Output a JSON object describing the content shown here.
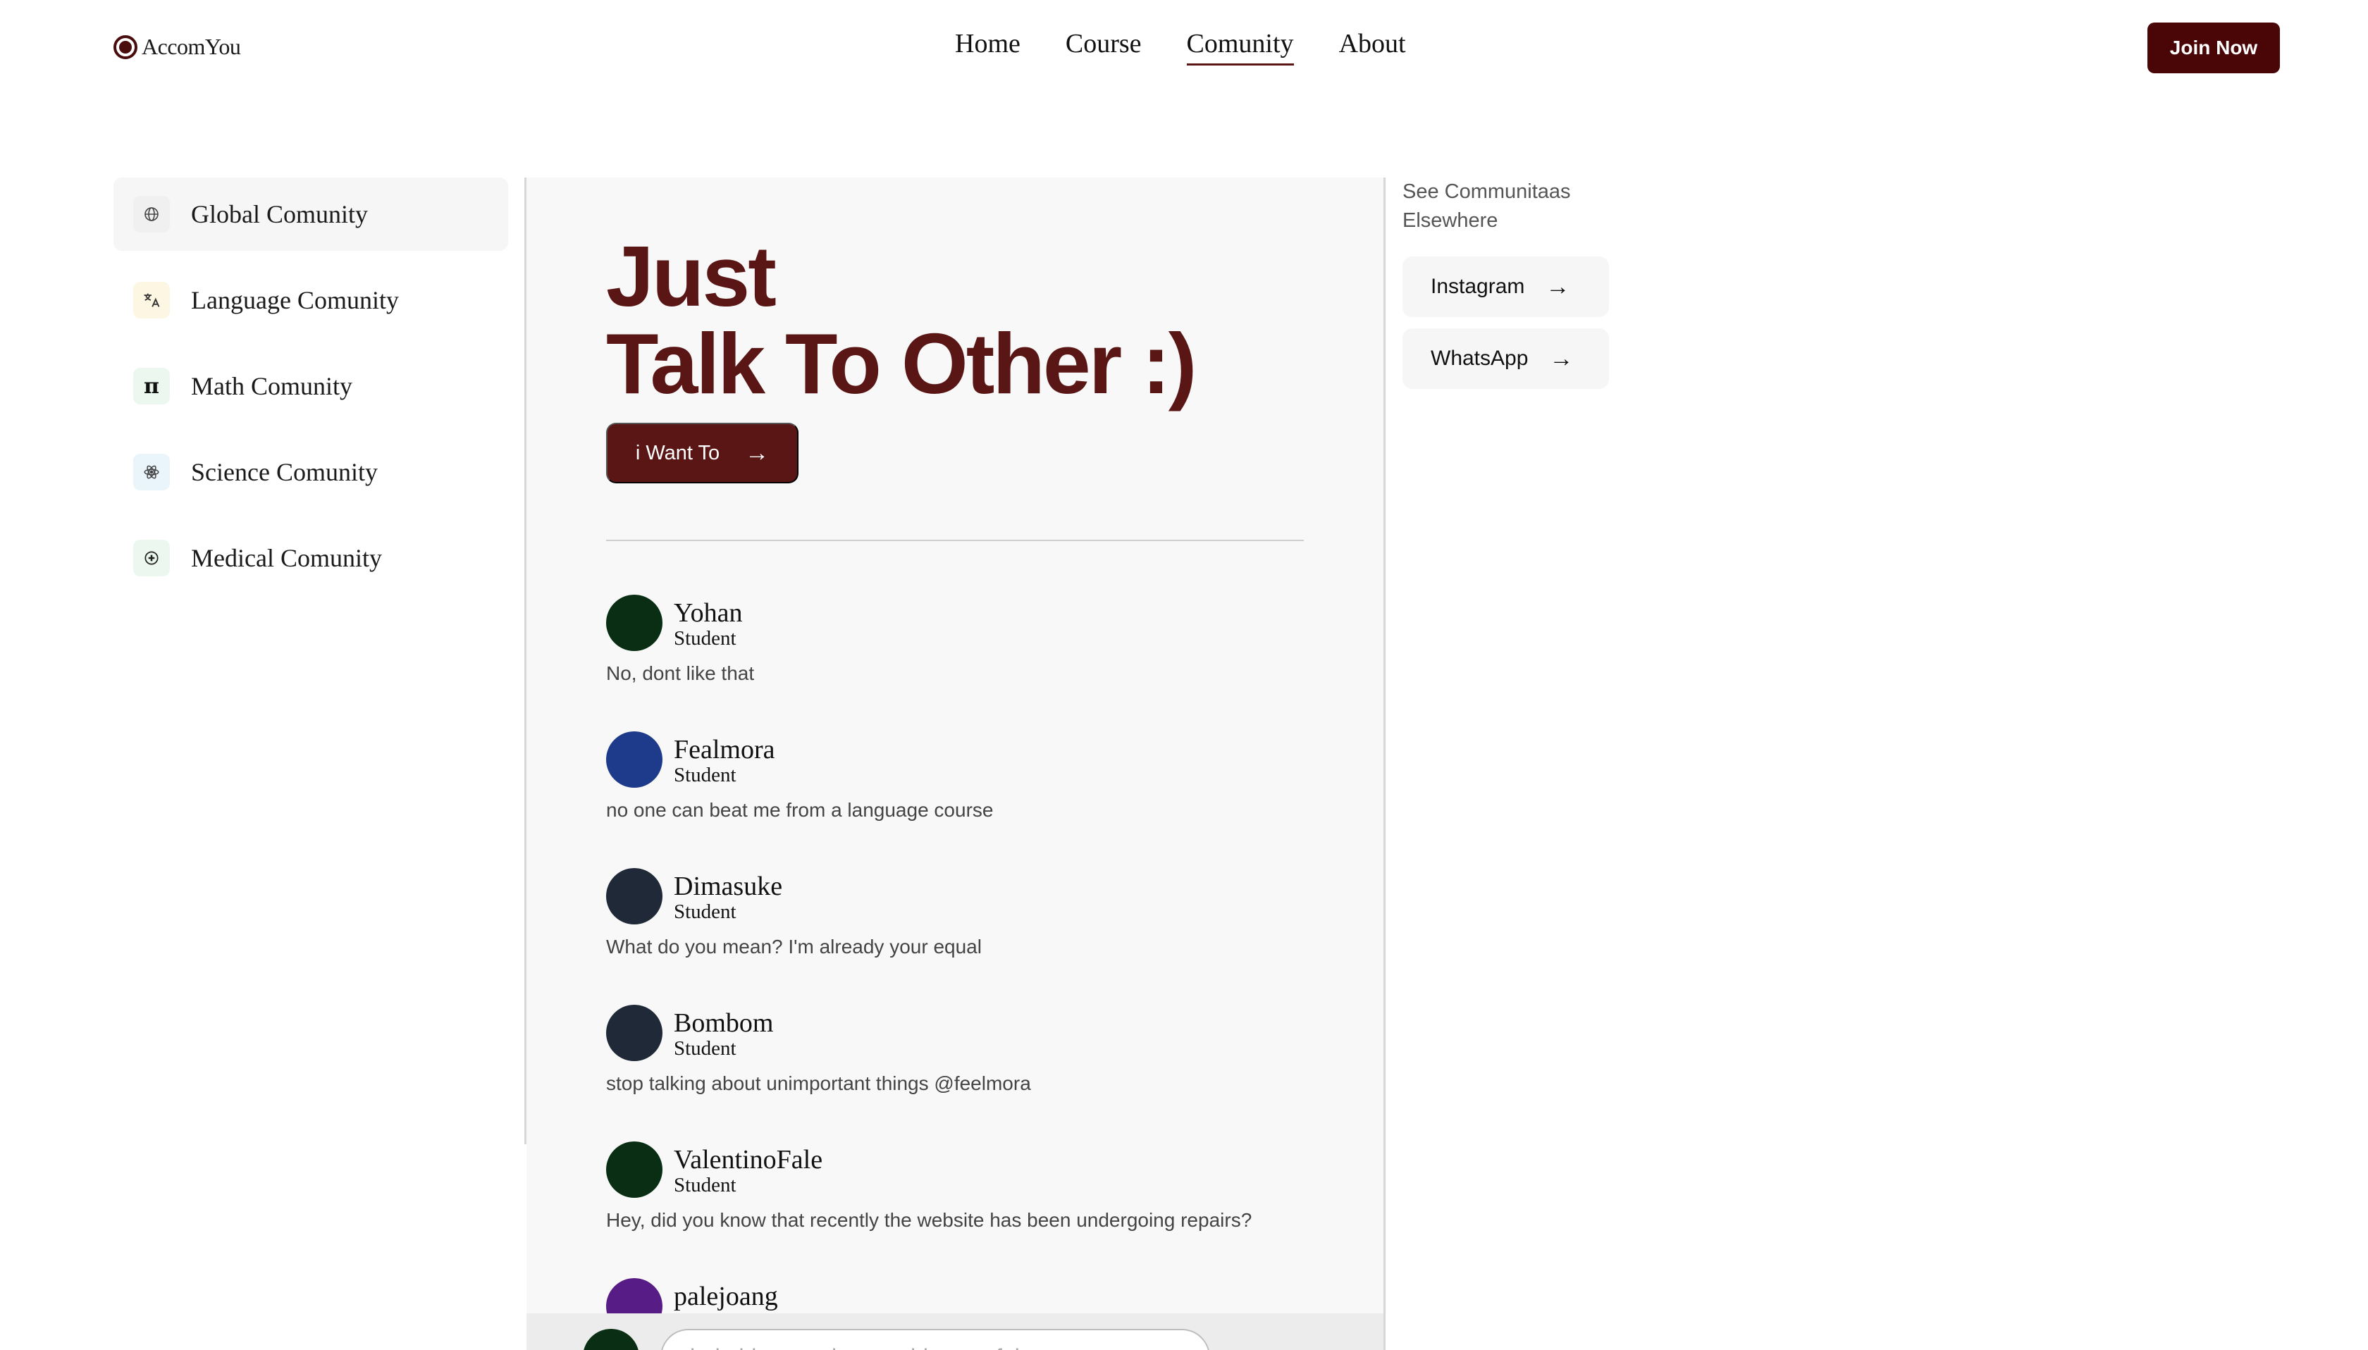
{
  "header": {
    "logo_text": "AccomYou",
    "nav": [
      {
        "label": "Home"
      },
      {
        "label": "Course"
      },
      {
        "label": "Comunity",
        "active": true
      },
      {
        "label": "About"
      }
    ],
    "join_label": "Join Now"
  },
  "sidebar": {
    "items": [
      {
        "label": "Global Comunity",
        "icon": "globe-icon",
        "active": true
      },
      {
        "label": "Language Comunity",
        "icon": "translate-icon"
      },
      {
        "label": "Math Comunity",
        "icon": "pi-icon"
      },
      {
        "label": "Science Comunity",
        "icon": "atom-icon"
      },
      {
        "label": "Medical Comunity",
        "icon": "medical-icon"
      }
    ]
  },
  "hero": {
    "line1": "Just",
    "line2": "Talk To Other :)",
    "cta_label": "i Want To"
  },
  "messages": [
    {
      "name": "Yohan",
      "role": "Student",
      "text": "No, dont like that",
      "avatar_color": "#0a2e14"
    },
    {
      "name": "Fealmora",
      "role": "Student",
      "text": "no one can beat me from a language course",
      "avatar_color": "#1e3a8a"
    },
    {
      "name": "Dimasuke",
      "role": "Student",
      "text": "What do you mean? I'm already your equal",
      "avatar_color": "#1f2937"
    },
    {
      "name": "Bombom",
      "role": "Student",
      "text": "stop talking about unimportant things @feelmora",
      "avatar_color": "#1f2937"
    },
    {
      "name": "ValentinoFale",
      "role": "Student",
      "text": "Hey, did you know that recently the website has been undergoing repairs?",
      "avatar_color": "#0a2e14"
    },
    {
      "name": "palejoang",
      "role": "",
      "text": "",
      "avatar_color": "#581c87"
    }
  ],
  "composer": {
    "placeholder": "help him or ask something useful...",
    "avatar_color": "#0a2e14"
  },
  "elsewhere": {
    "label": "See Communitaas Elsewhere",
    "links": [
      {
        "label": "Instagram"
      },
      {
        "label": "WhatsApp"
      }
    ]
  },
  "colors": {
    "brand": "#4a0606",
    "accent": "#5a1515"
  }
}
